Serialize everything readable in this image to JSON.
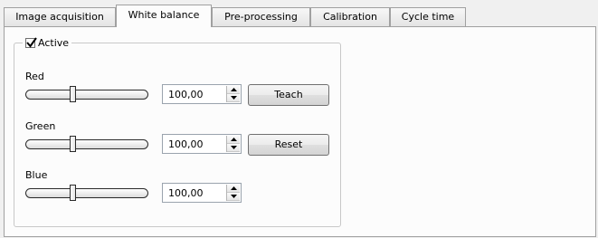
{
  "tabs": [
    {
      "label": "Image acquisition"
    },
    {
      "label": "White balance",
      "active": true
    },
    {
      "label": "Pre-processing"
    },
    {
      "label": "Calibration"
    },
    {
      "label": "Cycle time"
    }
  ],
  "group": {
    "active_label": "Active",
    "active_checked": true
  },
  "channels": [
    {
      "label": "Red",
      "value": "100,00",
      "slider_fraction": 0.38,
      "button": "Teach"
    },
    {
      "label": "Green",
      "value": "100,00",
      "slider_fraction": 0.38,
      "button": "Reset"
    },
    {
      "label": "Blue",
      "value": "100,00",
      "slider_fraction": 0.38
    }
  ],
  "colors": {
    "background": "#f0f0f0",
    "panel": "#fcfcfc",
    "border": "#a0a0a0"
  }
}
